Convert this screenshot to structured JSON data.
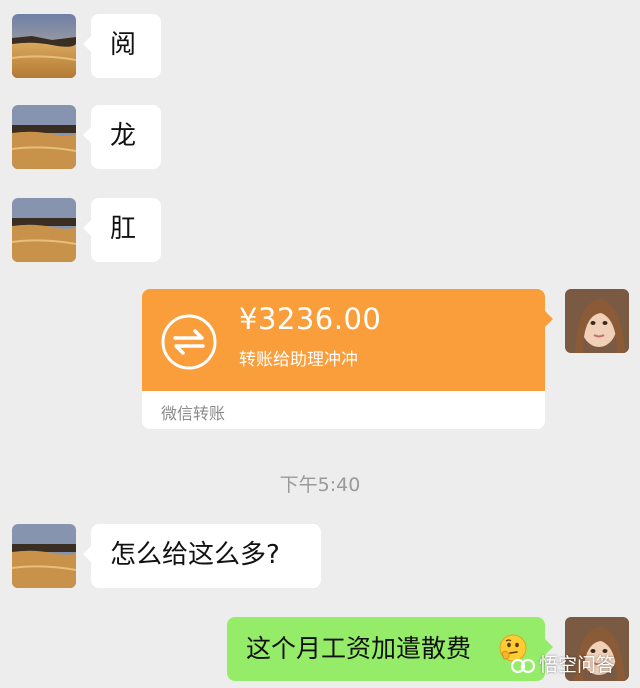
{
  "colors": {
    "background": "#ededed",
    "incoming_bubble": "#ffffff",
    "outgoing_bubble": "#95ec69",
    "transfer_card": "#fa9d3b",
    "timestamp_text": "#9a9a9a"
  },
  "messages": [
    {
      "side": "left",
      "type": "text",
      "text": "阅"
    },
    {
      "side": "left",
      "type": "text",
      "text": "龙"
    },
    {
      "side": "left",
      "type": "text",
      "text": "肛"
    },
    {
      "side": "right",
      "type": "transfer",
      "amount": "¥3236.00",
      "description": "转账给助理冲冲",
      "source": "微信转账",
      "icon": "transfer-arrows-icon"
    },
    {
      "type": "timestamp",
      "text": "下午5:40"
    },
    {
      "side": "left",
      "type": "text",
      "text": "怎么给这么多?"
    },
    {
      "side": "right",
      "type": "text",
      "text": "这个月工资加遣散费",
      "emoji": "thinking-face-emoji"
    }
  ],
  "watermark": {
    "text": "悟空问答",
    "logo": "wukong-logo-icon"
  }
}
